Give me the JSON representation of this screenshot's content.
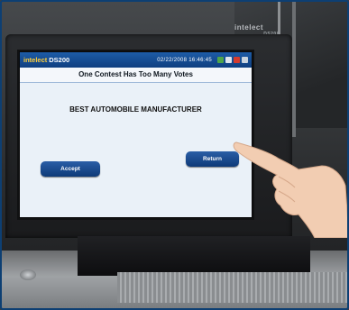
{
  "device": {
    "brand_label": "intelect",
    "model_label": "DS200"
  },
  "screen": {
    "logo": "intelect",
    "model": "DS200",
    "datetime": "02/22/2008 16:46:45",
    "heading": "One Contest Has Too Many Votes",
    "contest_name": "BEST AUTOMOBILE MANUFACTURER",
    "accept_label": "Accept",
    "return_label": "Return"
  },
  "colors": {
    "topbar": "#1d5ca7",
    "button": "#1a4a8e",
    "logo": "#ffce3a"
  }
}
